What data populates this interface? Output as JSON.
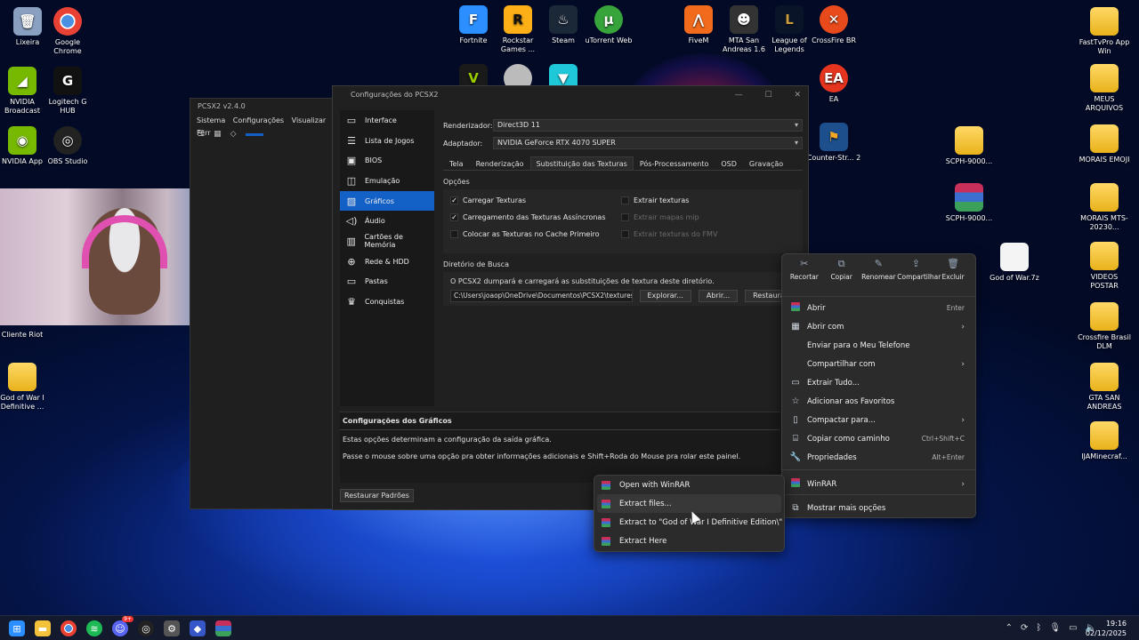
{
  "desktop": {
    "icons": [
      {
        "label": "Lixeira"
      },
      {
        "label": "Google Chrome"
      },
      {
        "label": "NVIDIA Broadcast"
      },
      {
        "label": "Logitech G HUB"
      },
      {
        "label": "NVIDIA App"
      },
      {
        "label": "OBS Studio"
      },
      {
        "label": "Cliente Riot"
      },
      {
        "label": "God of War I Definitive ..."
      },
      {
        "label": "Fortnite"
      },
      {
        "label": "Rockstar Games ..."
      },
      {
        "label": "Steam"
      },
      {
        "label": "uTorrent Web"
      },
      {
        "label": "FiveM"
      },
      {
        "label": "MTA San Andreas 1.6"
      },
      {
        "label": "League of Legends"
      },
      {
        "label": "CrossFire BR"
      },
      {
        "label": "EA"
      },
      {
        "label": "Counter-Str... 2"
      },
      {
        "label": "SCPH-9000..."
      },
      {
        "label": "SCPH-9000..."
      },
      {
        "label": "God of War.7z"
      },
      {
        "label": "FastTvPro App Win"
      },
      {
        "label": "MEUS ARQUIVOS"
      },
      {
        "label": "MORAIS EMOJI"
      },
      {
        "label": "MORAIS MTS-20230..."
      },
      {
        "label": "VIDEOS POSTAR"
      },
      {
        "label": "Crossfire Brasil DLM"
      },
      {
        "label": "GTA SAN ANDREAS"
      },
      {
        "label": "IJAMinecraf..."
      }
    ]
  },
  "pcsx2_main": {
    "title": "PCSX2 v2.4.0",
    "menu": [
      "Sistema",
      "Configurações",
      "Visualizar",
      "Ferr"
    ]
  },
  "settings": {
    "title": "Configurações do PCSX2",
    "sidebar": [
      {
        "label": "Interface",
        "icon": "monitor-icon"
      },
      {
        "label": "Lista de Jogos",
        "icon": "list-icon"
      },
      {
        "label": "BIOS",
        "icon": "chip-icon"
      },
      {
        "label": "Emulação",
        "icon": "gamepad-icon"
      },
      {
        "label": "Gráficos",
        "icon": "image-icon"
      },
      {
        "label": "Áudio",
        "icon": "speaker-icon"
      },
      {
        "label": "Cartões de Memória",
        "icon": "memory-card-icon"
      },
      {
        "label": "Rede & HDD",
        "icon": "globe-icon"
      },
      {
        "label": "Pastas",
        "icon": "folder-icon"
      },
      {
        "label": "Conquistas",
        "icon": "trophy-icon"
      }
    ],
    "renderer_label": "Renderizador:",
    "renderer_value": "Direct3D 11",
    "adapter_label": "Adaptador:",
    "adapter_value": "NVIDIA GeForce RTX 4070 SUPER",
    "tabs": [
      "Tela",
      "Renderização",
      "Substituição das Texturas",
      "Pós-Processamento",
      "OSD",
      "Gravação"
    ],
    "options_title": "Opções",
    "options": {
      "load_textures": "Carregar Texturas",
      "async_loading": "Carregamento das Texturas Assíncronas",
      "precache": "Colocar as Texturas no Cache Primeiro",
      "dump_textures": "Extrair texturas",
      "dump_mipmaps": "Extrair mapas mip",
      "dump_fmv": "Extrair texturas do FMV"
    },
    "search_dir_title": "Diretório de Busca",
    "search_dir_desc": "O PCSX2 dumpará e carregará as substituições de textura deste diretório.",
    "search_dir_path": "C:\\Users\\joaop\\OneDrive\\Documentos\\PCSX2\\textures",
    "browse_label": "Explorar...",
    "open_label": "Abrir...",
    "reset_label": "Restaurar",
    "desc_title": "Configurações dos Gráficos",
    "desc_line1": "Estas opções determinam a configuração da saída gráfica.",
    "desc_line2": "Passe o mouse sobre uma opção pra obter informações adicionais e Shift+Roda do Mouse pra rolar este painel.",
    "restore_defaults": "Restaurar Padrões"
  },
  "context_menu": {
    "quick_actions": [
      {
        "label": "Recortar",
        "icon": "scissors-icon"
      },
      {
        "label": "Copiar",
        "icon": "copy-icon"
      },
      {
        "label": "Renomear",
        "icon": "rename-icon"
      },
      {
        "label": "Compartilhar",
        "icon": "share-icon"
      },
      {
        "label": "Excluir",
        "icon": "trash-icon"
      }
    ],
    "items": [
      {
        "label": "Abrir",
        "shortcut": "Enter"
      },
      {
        "label": "Abrir com"
      },
      {
        "label": "Enviar para o Meu Telefone"
      },
      {
        "label": "Compartilhar com"
      },
      {
        "label": "Extrair Tudo..."
      },
      {
        "label": "Adicionar aos Favoritos"
      },
      {
        "label": "Compactar para..."
      },
      {
        "label": "Copiar como caminho",
        "shortcut": "Ctrl+Shift+C"
      },
      {
        "label": "Propriedades",
        "shortcut": "Alt+Enter"
      },
      {
        "label": "WinRAR"
      },
      {
        "label": "Mostrar mais opções"
      }
    ]
  },
  "winrar_submenu": {
    "items": [
      {
        "label": "Open with WinRAR"
      },
      {
        "label": "Extract files..."
      },
      {
        "label": "Extract to \"God of War I Definitive Edition\\\""
      },
      {
        "label": "Extract Here"
      }
    ]
  },
  "taskbar": {
    "time": "19:16",
    "date": "02/12/2025",
    "discord_badge": "9+"
  }
}
